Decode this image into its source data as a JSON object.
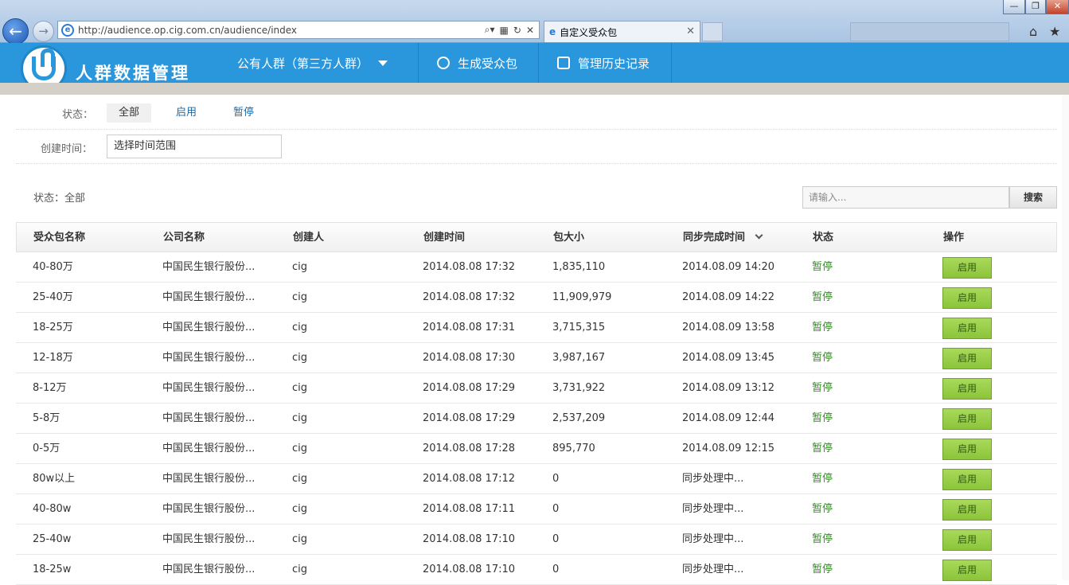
{
  "browser": {
    "url": "http://audience.op.cig.com.cn/audience/index",
    "tab_title": "自定义受众包",
    "window_controls": [
      "—",
      "❐"
    ]
  },
  "app": {
    "title": "人群数据管理",
    "nav": {
      "public": "公有人群（第三方人群）",
      "generate": "生成受众包",
      "history": "管理历史记录"
    }
  },
  "filters": {
    "status_label": "状态：",
    "status_options": [
      "全部",
      "启用",
      "暂停"
    ],
    "time_label": "创建时间：",
    "time_value": "选择时间范围"
  },
  "summary": "状态：全部",
  "search": {
    "placeholder": "请输入...",
    "button": "搜索"
  },
  "table": {
    "headers": [
      "受众包名称",
      "公司名称",
      "创建人",
      "创建时间",
      "包大小",
      "同步完成时间",
      "状态",
      "操作"
    ],
    "rows": [
      {
        "name": "40-80万",
        "company": "中国民生银行股份...",
        "creator": "cig",
        "created": "2014.08.08 17:32",
        "size": "1,835,110",
        "synced": "2014.08.09 14:20",
        "status": "暂停",
        "action": "启用"
      },
      {
        "name": "25-40万",
        "company": "中国民生银行股份...",
        "creator": "cig",
        "created": "2014.08.08 17:32",
        "size": "11,909,979",
        "synced": "2014.08.09 14:22",
        "status": "暂停",
        "action": "启用"
      },
      {
        "name": "18-25万",
        "company": "中国民生银行股份...",
        "creator": "cig",
        "created": "2014.08.08 17:31",
        "size": "3,715,315",
        "synced": "2014.08.09 13:58",
        "status": "暂停",
        "action": "启用"
      },
      {
        "name": "12-18万",
        "company": "中国民生银行股份...",
        "creator": "cig",
        "created": "2014.08.08 17:30",
        "size": "3,987,167",
        "synced": "2014.08.09 13:45",
        "status": "暂停",
        "action": "启用"
      },
      {
        "name": "8-12万",
        "company": "中国民生银行股份...",
        "creator": "cig",
        "created": "2014.08.08 17:29",
        "size": "3,731,922",
        "synced": "2014.08.09 13:12",
        "status": "暂停",
        "action": "启用"
      },
      {
        "name": "5-8万",
        "company": "中国民生银行股份...",
        "creator": "cig",
        "created": "2014.08.08 17:29",
        "size": "2,537,209",
        "synced": "2014.08.09 12:44",
        "status": "暂停",
        "action": "启用"
      },
      {
        "name": "0-5万",
        "company": "中国民生银行股份...",
        "creator": "cig",
        "created": "2014.08.08 17:28",
        "size": "895,770",
        "synced": "2014.08.09 12:15",
        "status": "暂停",
        "action": "启用"
      },
      {
        "name": "80w以上",
        "company": "中国民生银行股份...",
        "creator": "cig",
        "created": "2014.08.08 17:12",
        "size": "0",
        "synced": "同步处理中...",
        "status": "暂停",
        "action": "启用"
      },
      {
        "name": "40-80w",
        "company": "中国民生银行股份...",
        "creator": "cig",
        "created": "2014.08.08 17:11",
        "size": "0",
        "synced": "同步处理中...",
        "status": "暂停",
        "action": "启用"
      },
      {
        "name": "25-40w",
        "company": "中国民生银行股份...",
        "creator": "cig",
        "created": "2014.08.08 17:10",
        "size": "0",
        "synced": "同步处理中...",
        "status": "暂停",
        "action": "启用"
      },
      {
        "name": "18-25w",
        "company": "中国民生银行股份...",
        "creator": "cig",
        "created": "2014.08.08 17:10",
        "size": "0",
        "synced": "同步处理中...",
        "status": "暂停",
        "action": "启用"
      }
    ]
  },
  "colors": {
    "header_blue": "#2a97dc",
    "status_green": "#2f8f1f",
    "button_green": "#8bc43b",
    "link_blue": "#1c6aa8"
  }
}
